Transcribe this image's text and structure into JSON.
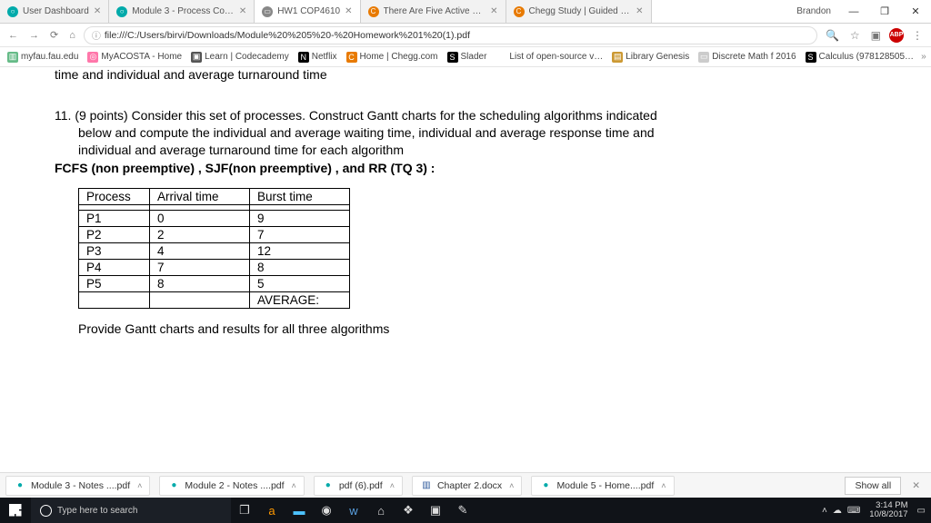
{
  "window": {
    "username": "Brandon"
  },
  "tabs": [
    {
      "label": "User Dashboard",
      "fav": "○",
      "favbg": "#0aa"
    },
    {
      "label": "Module 3 - Process Con…",
      "fav": "○",
      "favbg": "#0aa"
    },
    {
      "label": "HW1 COP4610",
      "fav": "▭",
      "favbg": "#888",
      "active": true
    },
    {
      "label": "There Are Five Active Pr…",
      "fav": "C",
      "favbg": "#e87a00"
    },
    {
      "label": "Chegg Study | Guided S…",
      "fav": "C",
      "favbg": "#e87a00"
    }
  ],
  "address": {
    "url": "file:///C:/Users/birvi/Downloads/Module%20%205%20-%20Homework%201%20(1).pdf"
  },
  "bookmarks": [
    {
      "label": "myfau.fau.edu",
      "ico": "▥",
      "bg": "#6b8"
    },
    {
      "label": "MyACOSTA - Home",
      "ico": "◎",
      "bg": "#f7a"
    },
    {
      "label": "Learn | Codecademy",
      "ico": "▣",
      "bg": "#555"
    },
    {
      "label": "Netflix",
      "ico": "N",
      "bg": "#000"
    },
    {
      "label": "Home | Chegg.com",
      "ico": "C",
      "bg": "#e87a00"
    },
    {
      "label": "Slader",
      "ico": "S",
      "bg": "#000"
    },
    {
      "label": "List of open-source v…",
      "ico": "W",
      "bg": "#fff"
    },
    {
      "label": "Library Genesis",
      "ico": "▤",
      "bg": "#c93"
    },
    {
      "label": "Discrete Math f 2016",
      "ico": "▭",
      "bg": "#ccc"
    },
    {
      "label": "Calculus (978128505…",
      "ico": "S",
      "bg": "#000"
    }
  ],
  "doc": {
    "truncated_top": "time and individual and average turnaround time",
    "q_prefix": "11. (9 points) ",
    "q_line1": "Consider this set of processes. Construct Gantt charts for the scheduling algorithms indicated",
    "q_line2": "below and compute the individual and average waiting time, individual and average response time and",
    "q_line3": "individual and average turnaround time for each algorithm",
    "algos": "FCFS (non preemptive) ,   SJF(non preemptive) ,  and   RR (TQ 3) :",
    "table_headers": {
      "c1": "Process",
      "c2": "Arrival time",
      "c3": "Burst time"
    },
    "rows": [
      {
        "p": "P1",
        "a": "0",
        "b": "9"
      },
      {
        "p": "P2",
        "a": "2",
        "b": "7"
      },
      {
        "p": "P3",
        "a": "4",
        "b": "12"
      },
      {
        "p": "P4",
        "a": "7",
        "b": "8"
      },
      {
        "p": "P5",
        "a": "8",
        "b": "5"
      }
    ],
    "avg_label": "AVERAGE:",
    "instruction": "Provide Gantt charts and results for all three algorithms"
  },
  "downloads": [
    {
      "label": "Module 3 - Notes ....pdf",
      "ico": "●",
      "color": "#0aa"
    },
    {
      "label": "Module 2 - Notes ....pdf",
      "ico": "●",
      "color": "#0aa"
    },
    {
      "label": "pdf (6).pdf",
      "ico": "●",
      "color": "#0aa"
    },
    {
      "label": "Chapter 2.docx",
      "ico": "▥",
      "color": "#2a5699"
    },
    {
      "label": "Module  5 - Home....pdf",
      "ico": "●",
      "color": "#0aa"
    }
  ],
  "dlbar": {
    "showall": "Show all"
  },
  "taskbar": {
    "search_placeholder": "Type here to search",
    "time": "3:14 PM",
    "date": "10/8/2017"
  }
}
